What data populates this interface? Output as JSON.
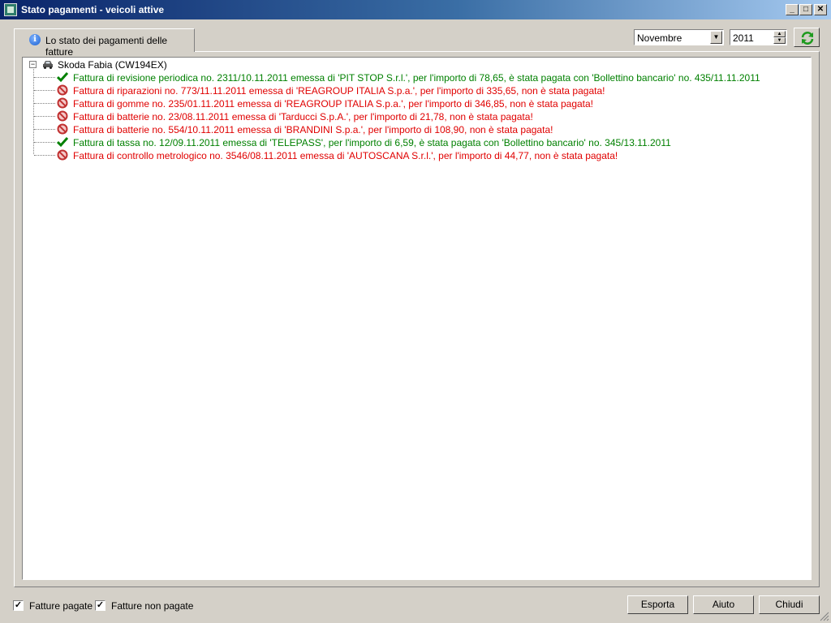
{
  "window": {
    "title": "Stato pagamenti - veicoli attive",
    "minimize_label": "_",
    "maximize_label": "□",
    "close_label": "✕"
  },
  "tab": {
    "label": "Lo stato dei pagamenti delle fatture",
    "icon_glyph": "i"
  },
  "filters": {
    "month": "Novembre",
    "year": "2011"
  },
  "tree": {
    "expander": "−",
    "root_label": "Skoda Fabia (CW194EX)",
    "items": [
      {
        "status": "paid",
        "text": "Fattura di revisione periodica no. 2311/10.11.2011 emessa di 'PIT STOP S.r.l.', per l'importo di 78,65, è stata pagata con 'Bollettino bancario' no. 435/11.11.2011"
      },
      {
        "status": "unpaid",
        "text": "Fattura di riparazioni no. 773/11.11.2011 emessa di 'REAGROUP ITALIA S.p.a.', per l'importo di 335,65, non è stata pagata!"
      },
      {
        "status": "unpaid",
        "text": "Fattura di gomme no. 235/01.11.2011 emessa di 'REAGROUP ITALIA S.p.a.', per l'importo di 346,85, non è stata pagata!"
      },
      {
        "status": "unpaid",
        "text": "Fattura di batterie no. 23/08.11.2011 emessa di 'Tarducci S.p.A.', per l'importo di 21,78, non è stata pagata!"
      },
      {
        "status": "unpaid",
        "text": "Fattura di batterie no. 554/10.11.2011 emessa di 'BRANDINI S.p.a.', per l'importo di 108,90, non è stata pagata!"
      },
      {
        "status": "paid",
        "text": "Fattura di tassa no. 12/09.11.2011 emessa di 'TELEPASS', per l'importo di 6,59, è stata pagata con 'Bollettino bancario' no. 345/13.11.2011"
      },
      {
        "status": "unpaid",
        "text": "Fattura di controllo metrologico no. 3546/08.11.2011 emessa di 'AUTOSCANA S.r.l.', per l'importo di 44,77, non è stata pagata!"
      }
    ]
  },
  "footer": {
    "check_paid_label": "Fatture pagate",
    "check_unpaid_label": "Fatture non pagate",
    "check_paid_checked": true,
    "check_unpaid_checked": true,
    "export_label": "Esporta",
    "help_label": "Aiuto",
    "close_label": "Chiudi",
    "check_mark": "✓"
  },
  "colors": {
    "paid": "#008000",
    "unpaid": "#e00000",
    "titlebar": "#0a246a"
  }
}
